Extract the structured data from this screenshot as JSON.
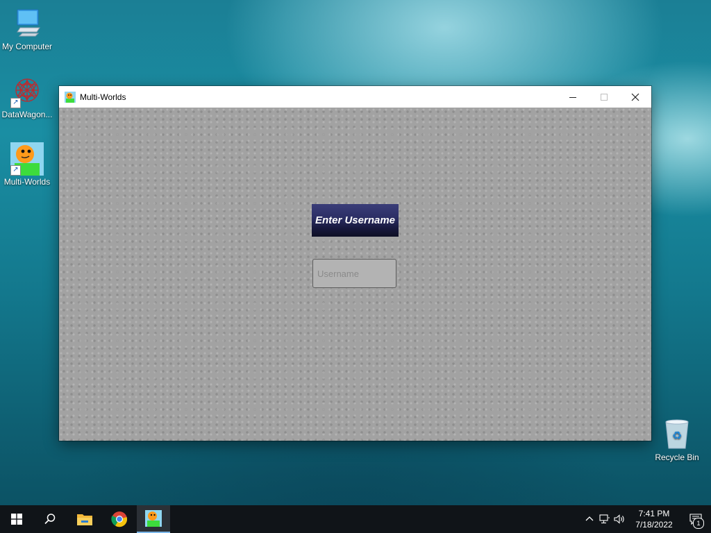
{
  "desktop": {
    "icons": [
      {
        "label": "My Computer",
        "icon": "computer-icon"
      },
      {
        "label": "DataWagon...",
        "icon": "datawagon-icon"
      },
      {
        "label": "Multi-Worlds",
        "icon": "multi-worlds-icon"
      },
      {
        "label": "Recycle Bin",
        "icon": "recycle-bin-icon"
      }
    ]
  },
  "window": {
    "title": "Multi-Worlds",
    "controls": {
      "minimize": "minimize-icon",
      "maximize": "maximize-icon",
      "close": "close-icon"
    }
  },
  "login": {
    "heading": "Enter Username",
    "input_placeholder": "Username",
    "input_value": ""
  },
  "taskbar": {
    "start": "windows-start-icon",
    "search": "search-icon",
    "pinned": [
      "file-explorer-icon",
      "chrome-icon",
      "multi-worlds-icon"
    ],
    "clock": {
      "time": "7:41 PM",
      "date": "7/18/2022"
    },
    "notifications_count": "1"
  },
  "colors": {
    "heading_bg": "#2c2f66",
    "content_bg": "#a2a2a2",
    "taskbar_bg": "#101418"
  }
}
